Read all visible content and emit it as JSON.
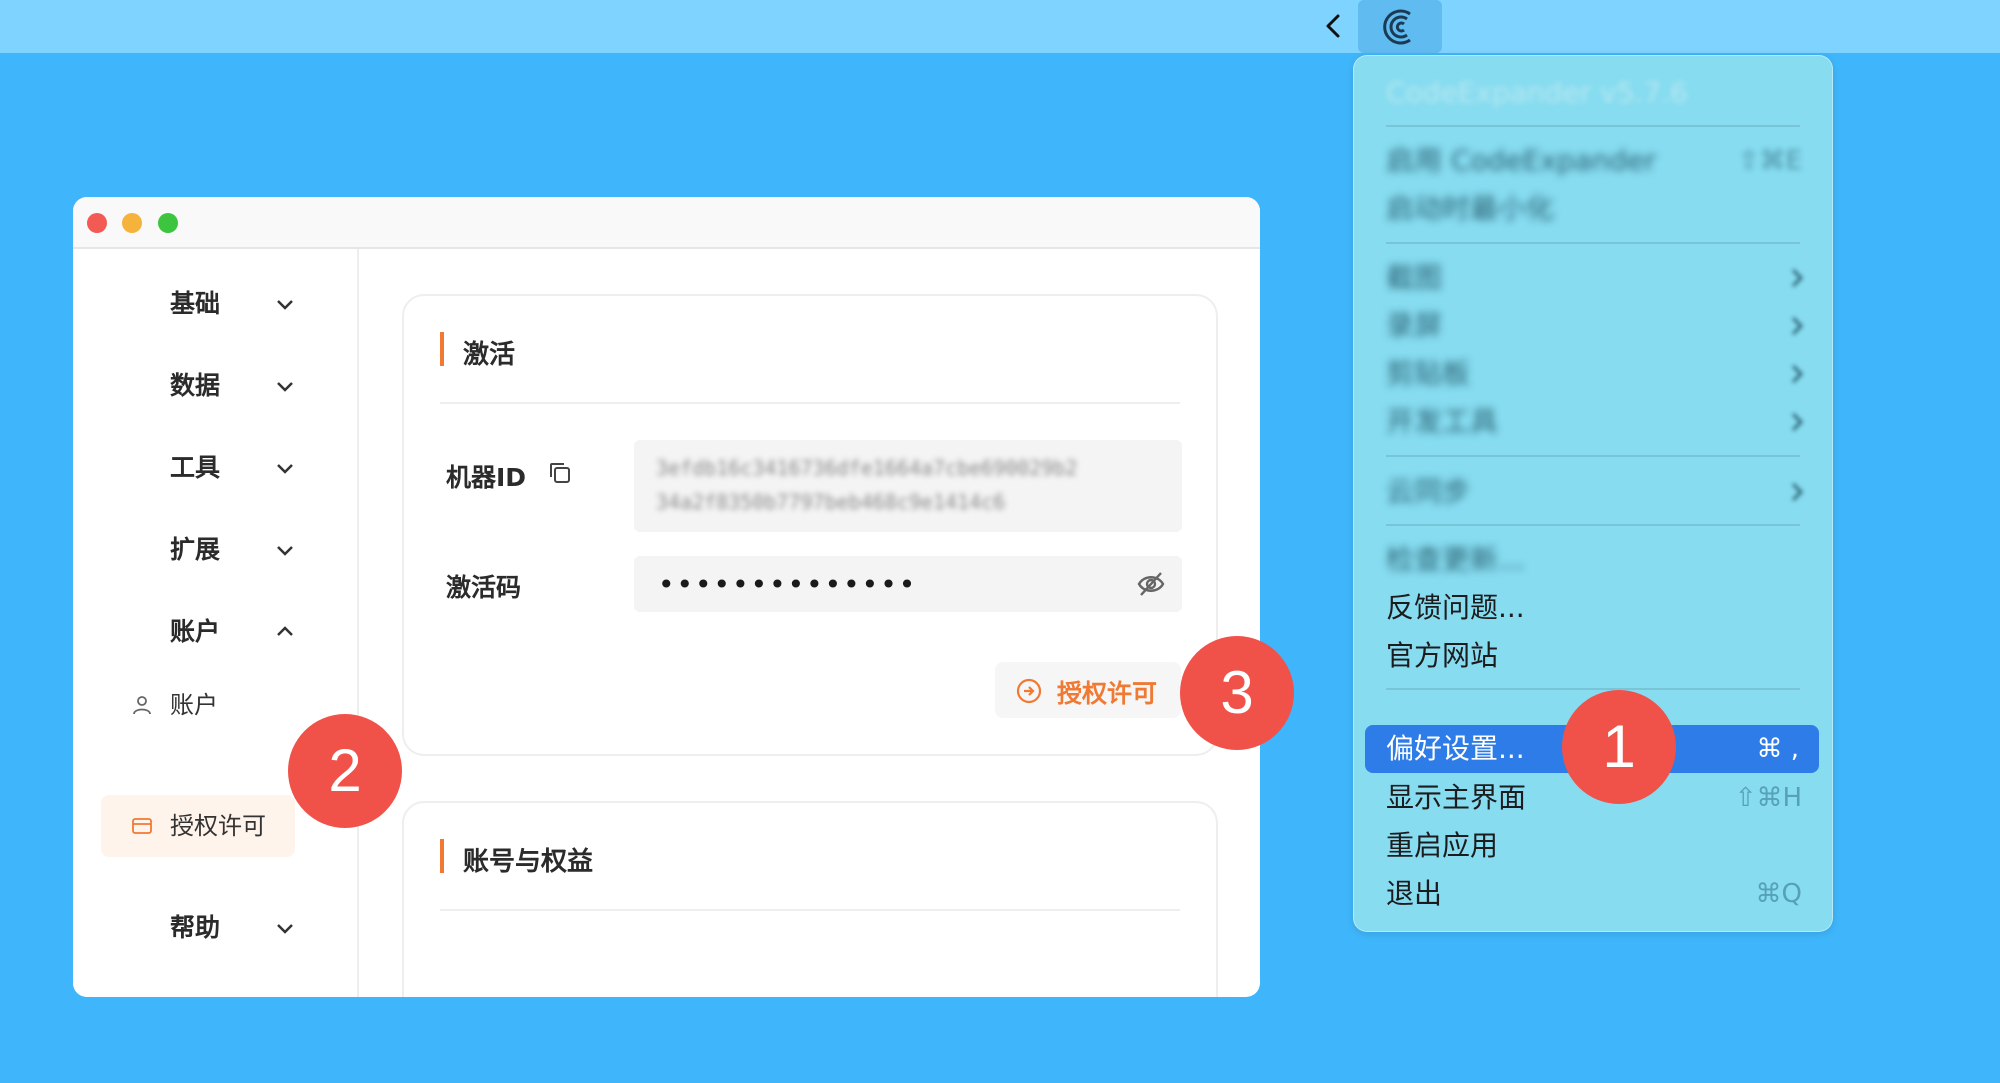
{
  "menu": {
    "header": "CodeExpander v5.7.6",
    "enable": "启用 CodeExpander",
    "enable_shortcut": "⇧⌘E",
    "launch": "启动时最小化",
    "sub1": "截图",
    "sub2": "录屏",
    "sub3": "剪贴板",
    "sub4": "开发工具",
    "sync": "云同步",
    "check_update": "检查更新...",
    "feedback": "反馈问题...",
    "website": "官方网站",
    "preferences": "偏好设置...",
    "preferences_shortcut": "⌘ ,",
    "show_main": "显示主界面",
    "show_main_shortcut": "⇧⌘H",
    "restart": "重启应用",
    "quit": "退出",
    "quit_shortcut": "⌘Q"
  },
  "sidebar": {
    "basic": "基础",
    "data": "数据",
    "tools": "工具",
    "extend": "扩展",
    "account": "账户",
    "account_sub": "账户",
    "license": "授权许可",
    "help": "帮助"
  },
  "activation": {
    "title": "激活",
    "machine_id_label": "机器ID",
    "machine_id_line1": "3efdb16c3416736dfe1664a7cbe690029b2",
    "machine_id_line2": "34a2f8350b7797beb468c9e1414c6",
    "code_label": "激活码",
    "code_value": "••••••••••••••",
    "license_button": "授权许可"
  },
  "account_card": {
    "title": "账号与权益"
  },
  "badges": {
    "b1": "1",
    "b2": "2",
    "b3": "3"
  },
  "colors": {
    "desktop": "#3fb6fb",
    "accent": "#f07a33",
    "badge": "#f0524a",
    "menu_select": "#2d7ce7"
  }
}
